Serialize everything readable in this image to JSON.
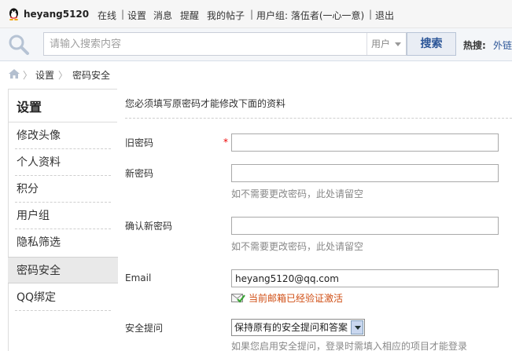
{
  "topbar": {
    "username": "heyang5120",
    "online": "在线",
    "settings": "设置",
    "messages": "消息",
    "reminders": "提醒",
    "my_posts": "我的帖子",
    "usergroup": "用户组: 落伍者(一心一意)",
    "logout": "退出",
    "sep": "|"
  },
  "search": {
    "placeholder": "请输入搜索内容",
    "scope": "用户",
    "button": "搜索",
    "hot_label": "热搜:",
    "hot_link": "外链"
  },
  "breadcrumb": {
    "items": [
      "设置",
      "密码安全"
    ],
    "arrow": "〉"
  },
  "sidebar": {
    "title": "设置",
    "items": [
      {
        "label": "修改头像"
      },
      {
        "label": "个人资料"
      },
      {
        "label": "积分"
      },
      {
        "label": "用户组"
      },
      {
        "label": "隐私筛选"
      },
      {
        "label": "密码安全"
      },
      {
        "label": "QQ绑定"
      }
    ]
  },
  "form": {
    "notice": "您必须填写原密码才能修改下面的资料",
    "old_password": {
      "label": "旧密码",
      "required": "*",
      "value": ""
    },
    "new_password": {
      "label": "新密码",
      "value": "",
      "hint": "如不需要更改密码，此处请留空"
    },
    "confirm_password": {
      "label": "确认新密码",
      "value": "",
      "hint": "如不需要更改密码，此处请留空"
    },
    "email": {
      "label": "Email",
      "value": "heyang5120@qq.com",
      "verified_text": "当前邮箱已经验证激活"
    },
    "security_question": {
      "label": "安全提问",
      "selected": "保持原有的安全提问和答案",
      "hint": "如果您启用安全提问，登录时需填入相应的项目才能登录"
    }
  }
}
